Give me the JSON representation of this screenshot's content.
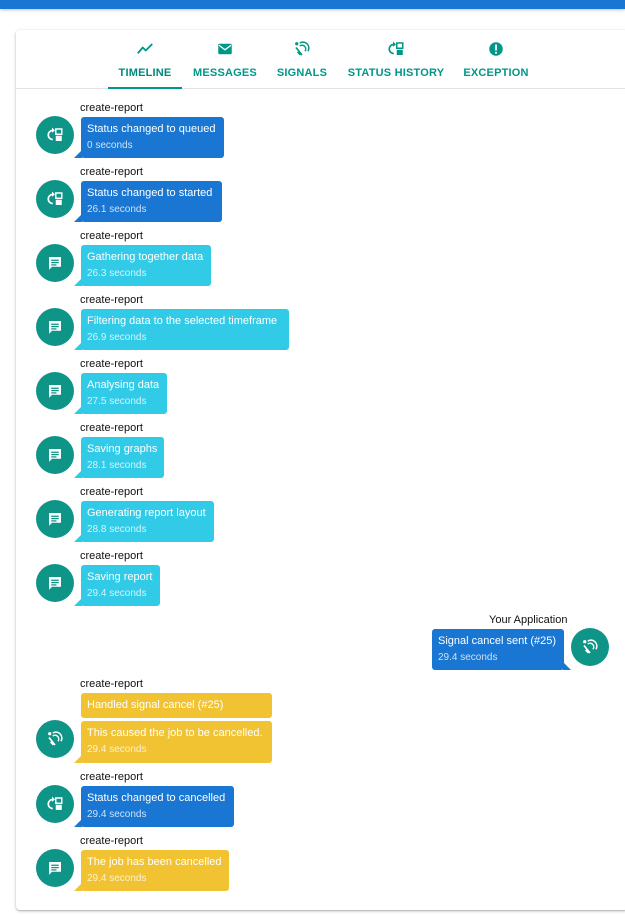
{
  "tabs": [
    {
      "label": "TIMELINE",
      "icon": "timeline-icon",
      "active": true
    },
    {
      "label": "MESSAGES",
      "icon": "email-icon",
      "active": false
    },
    {
      "label": "SIGNALS",
      "icon": "signal-icon",
      "active": false
    },
    {
      "label": "STATUS HISTORY",
      "icon": "status-history-icon",
      "active": false
    },
    {
      "label": "EXCEPTION",
      "icon": "exception-icon",
      "active": false
    }
  ],
  "colors": {
    "accent": "#009688",
    "status": "#1976d2",
    "message": "#31cbe8",
    "signal": "#f1c232",
    "topbar": "#1976d2"
  },
  "timeline": [
    {
      "author": "create-report",
      "kind": "status",
      "icon": "status-change-icon",
      "title": "Status changed to queued",
      "time": "0 seconds"
    },
    {
      "author": "create-report",
      "kind": "status",
      "icon": "status-change-icon",
      "title": "Status changed to started",
      "time": "26.1 seconds"
    },
    {
      "author": "create-report",
      "kind": "message",
      "icon": "message-icon",
      "title": "Gathering together data",
      "time": "26.3 seconds"
    },
    {
      "author": "create-report",
      "kind": "message",
      "icon": "message-icon",
      "title": "Filtering data to the selected timeframe",
      "time": "26.9 seconds"
    },
    {
      "author": "create-report",
      "kind": "message",
      "icon": "message-icon",
      "title": "Analysing data",
      "time": "27.5 seconds"
    },
    {
      "author": "create-report",
      "kind": "message",
      "icon": "message-icon",
      "title": "Saving graphs",
      "time": "28.1 seconds"
    },
    {
      "author": "create-report",
      "kind": "message",
      "icon": "message-icon",
      "title": "Generating report layout",
      "time": "28.8 seconds"
    },
    {
      "author": "create-report",
      "kind": "message",
      "icon": "message-icon",
      "title": "Saving report",
      "time": "29.4 seconds"
    },
    {
      "author": "Your Application",
      "kind": "signal-sent",
      "icon": "signal-icon",
      "title": "Signal cancel sent (#25)",
      "time": "29.4 seconds"
    },
    {
      "author": "create-report",
      "kind": "signal-handled",
      "icon": "signal-icon",
      "title": "Handled signal cancel (#25)",
      "detail": "This caused the job to be cancelled.",
      "time": "29.4 seconds"
    },
    {
      "author": "create-report",
      "kind": "status",
      "icon": "status-change-icon",
      "title": "Status changed to cancelled",
      "time": "29.4 seconds"
    },
    {
      "author": "create-report",
      "kind": "message-final",
      "icon": "message-icon",
      "title": "The job has been cancelled",
      "time": "29.4 seconds"
    }
  ]
}
